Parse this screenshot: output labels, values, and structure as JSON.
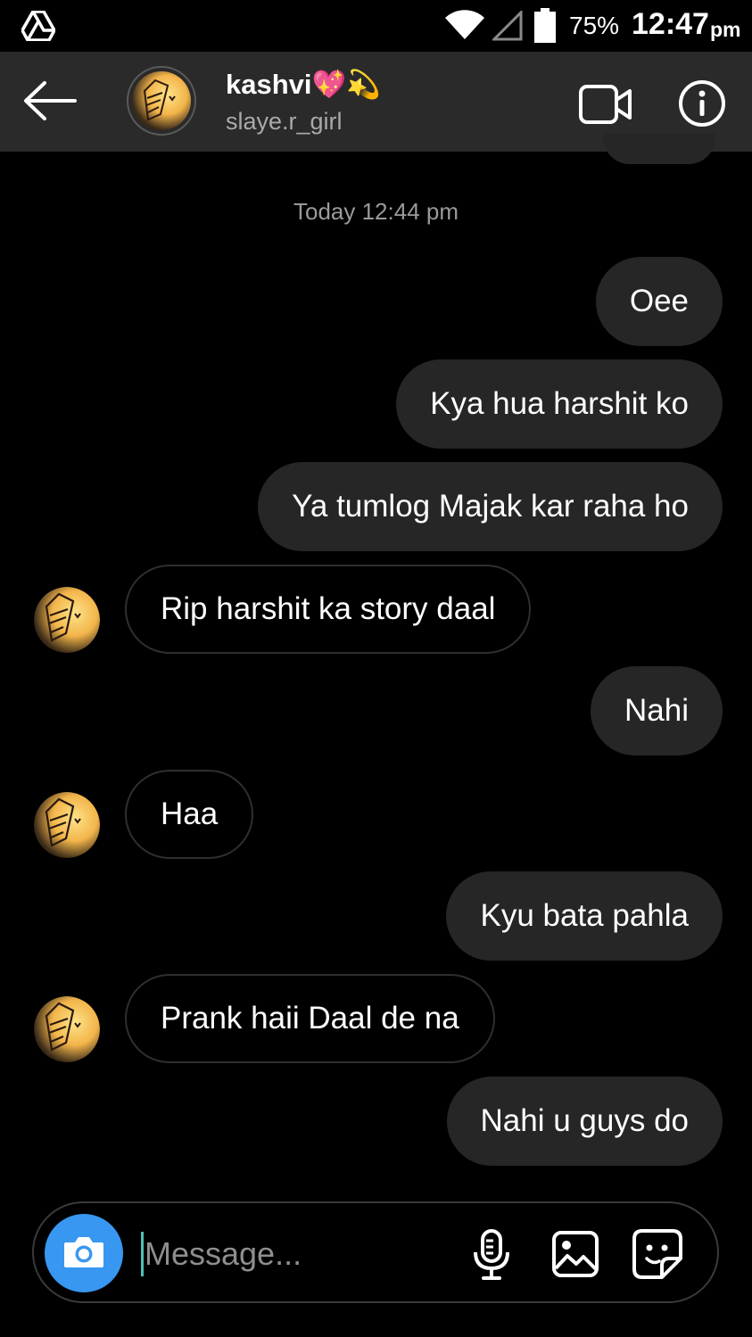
{
  "status_bar": {
    "battery_percent": "75%",
    "time": "12:47",
    "ampm": "pm",
    "icons": [
      "google-drive-icon",
      "wifi-icon",
      "signal-icon",
      "battery-icon"
    ]
  },
  "header": {
    "name": "kashvi",
    "name_emoji": "💖💫",
    "username": "slaye.r_girl",
    "icons": [
      "back-arrow-icon",
      "video-call-icon",
      "info-icon"
    ]
  },
  "chat": {
    "timestamp": "Today 12:44 pm",
    "messages": [
      {
        "from": "me",
        "text": "Oee"
      },
      {
        "from": "me",
        "text": "Kya hua harshit ko"
      },
      {
        "from": "me",
        "text": "Ya tumlog Majak kar raha ho"
      },
      {
        "from": "them",
        "text": "Rip harshit ka story daal"
      },
      {
        "from": "me",
        "text": "Nahi"
      },
      {
        "from": "them",
        "text": "Haa"
      },
      {
        "from": "me",
        "text": "Kyu bata pahla"
      },
      {
        "from": "them",
        "text": "Prank haii Daal de na"
      },
      {
        "from": "me",
        "text": "Nahi u guys do"
      }
    ]
  },
  "composer": {
    "placeholder": "Message...",
    "icons": [
      "camera-icon",
      "microphone-icon",
      "gallery-icon",
      "sticker-icon"
    ]
  },
  "colors": {
    "background": "#000000",
    "header_bg": "#2a2a2a",
    "outgoing_bubble": "#262626",
    "camera_button": "#3897f0",
    "muted_text": "#9a9a9a"
  }
}
